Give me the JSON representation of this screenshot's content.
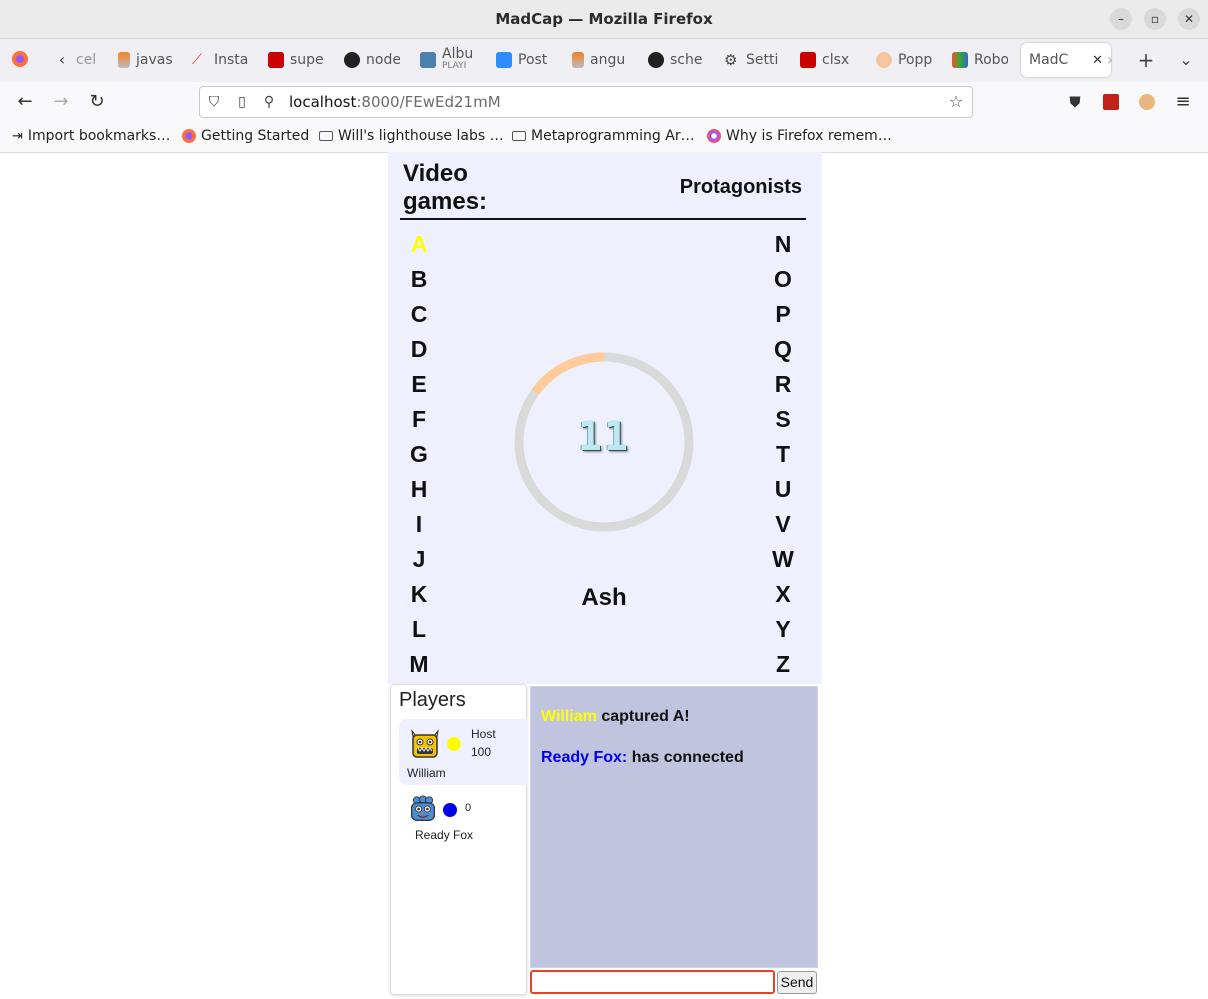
{
  "window": {
    "title": "MadCap — Mozilla Firefox"
  },
  "tabs": [
    {
      "label": "cel",
      "icon": "stackoverflow-icon"
    },
    {
      "label": "javas",
      "icon": "stackoverflow-icon"
    },
    {
      "label": "Insta",
      "icon": "insta-icon"
    },
    {
      "label": "supe",
      "icon": "npm-icon"
    },
    {
      "label": "node",
      "icon": "github-icon"
    },
    {
      "label": "Albu",
      "sub": "PLAYI",
      "icon": "album-icon"
    },
    {
      "label": "Post",
      "icon": "zoom-icon"
    },
    {
      "label": "angu",
      "icon": "stackoverflow-icon"
    },
    {
      "label": "sche",
      "icon": "github-icon"
    },
    {
      "label": "Setti",
      "icon": "gear-icon"
    },
    {
      "label": "clsx",
      "icon": "npm-icon"
    },
    {
      "label": "Popp",
      "icon": "popper-icon"
    },
    {
      "label": "Robo",
      "icon": "robo-icon"
    },
    {
      "label": "MadC",
      "icon": "none",
      "active": true
    }
  ],
  "url": {
    "host": "localhost",
    "path": ":8000/FEwEd21mM"
  },
  "bookmarks": [
    {
      "label": "Import bookmarks…",
      "icon": "import-icon"
    },
    {
      "label": "Getting Started",
      "icon": "firefox-icon"
    },
    {
      "label": "Will's lighthouse labs …",
      "icon": "folder-icon"
    },
    {
      "label": "Metaprogramming Ar…",
      "icon": "folder-icon"
    },
    {
      "label": "Why is Firefox remem…",
      "icon": "firefox-icon"
    }
  ],
  "game": {
    "category_left": "Video games:",
    "category_right": "Protagonists",
    "letters_left": [
      "A",
      "B",
      "C",
      "D",
      "E",
      "F",
      "G",
      "H",
      "I",
      "J",
      "K",
      "L",
      "M"
    ],
    "letters_right": [
      "N",
      "O",
      "P",
      "Q",
      "R",
      "S",
      "T",
      "U",
      "V",
      "W",
      "X",
      "Y",
      "Z"
    ],
    "captured": {
      "A": "#ffff00"
    },
    "timer": {
      "value": "11",
      "progress": 0.15,
      "track_color": "#d9d9d9",
      "fill_color": "#ffcc99"
    },
    "answer": "Ash"
  },
  "players": {
    "title": "Players",
    "list": [
      {
        "name": "William",
        "role": "Host",
        "score": "100",
        "color": "#ffff00",
        "avatar": "yellow-monster-avatar"
      },
      {
        "name": "Ready Fox",
        "role": "",
        "score": "0",
        "color": "#0000ee",
        "avatar": "blue-monster-avatar"
      }
    ]
  },
  "chat": {
    "messages": [
      {
        "name": "William",
        "name_color": "#ffff00",
        "text": " captured A!"
      },
      {
        "name": "Ready Fox:",
        "name_color": "#0000ee",
        "text": " has connected"
      }
    ],
    "input_value": "",
    "send_label": "Send"
  }
}
